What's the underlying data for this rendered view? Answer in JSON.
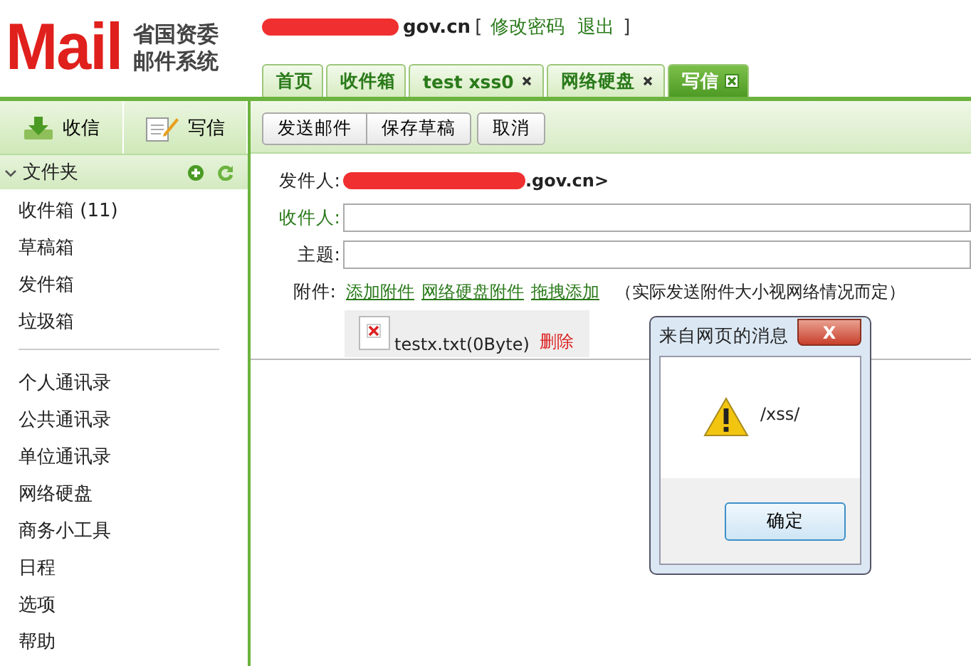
{
  "logo": {
    "mark": "Mail",
    "line1": "省国资委",
    "line2": "邮件系统"
  },
  "account": {
    "email": "gov.cn",
    "open": "[",
    "links": [
      "修改密码",
      "退出"
    ],
    "close": "]"
  },
  "tabs": [
    {
      "label": "首页",
      "closable": false,
      "selected": false
    },
    {
      "label": "收件箱",
      "closable": false,
      "selected": false
    },
    {
      "label": "test xss0",
      "closable": true,
      "selected": false
    },
    {
      "label": "网络硬盘",
      "closable": true,
      "selected": false
    },
    {
      "label": "写信",
      "closable": true,
      "selected": true
    }
  ],
  "sidebar": {
    "actions": [
      {
        "label": "收信",
        "kind": "receive"
      },
      {
        "label": "写信",
        "kind": "compose"
      }
    ],
    "folder_header": {
      "label": "文件夹",
      "expanded": true
    },
    "folders": [
      {
        "label": "收件箱 (11)"
      },
      {
        "label": "草稿箱"
      },
      {
        "label": "发件箱"
      },
      {
        "label": "垃圾箱"
      }
    ],
    "tools": [
      {
        "label": "个人通讯录"
      },
      {
        "label": "公共通讯录"
      },
      {
        "label": "单位通讯录"
      },
      {
        "label": "网络硬盘"
      },
      {
        "label": "商务小工具"
      },
      {
        "label": "日程"
      },
      {
        "label": "选项"
      },
      {
        "label": "帮助"
      }
    ]
  },
  "toolbar": {
    "buttons": [
      "发送邮件",
      "保存草稿",
      "取消"
    ]
  },
  "compose": {
    "from_label": "发件人:",
    "from_value": ".gov.cn>",
    "to_label": "收件人:",
    "subject_label": "主题:",
    "attach_label": "附件:",
    "attach_links": [
      "添加附件",
      "网络硬盘附件",
      "拖拽添加"
    ],
    "attach_note": "（实际发送附件大小视网络情况而定）",
    "attachment": {
      "name": "testx.txt(0Byte)",
      "delete": "删除"
    }
  },
  "dialog": {
    "title": "来自网页的消息",
    "close": "X",
    "message": "/xss/",
    "ok": "确定"
  }
}
